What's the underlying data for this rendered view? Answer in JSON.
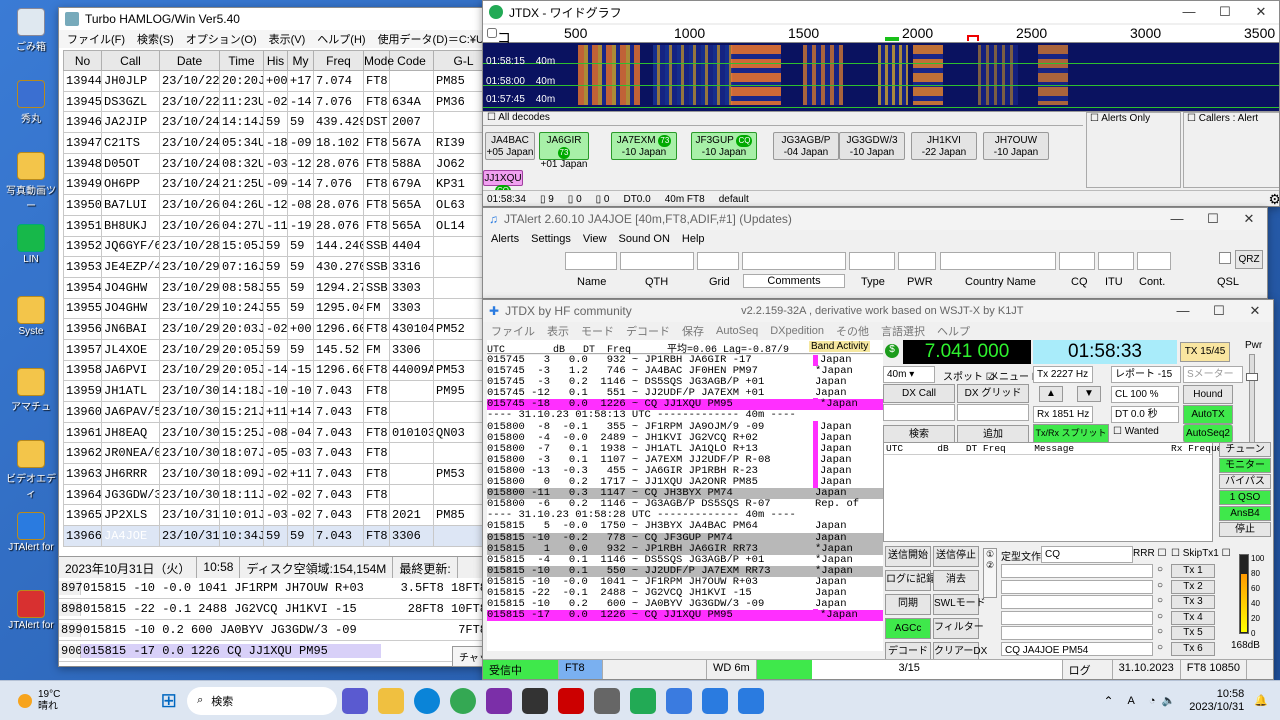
{
  "desktop": {
    "icons": [
      {
        "label": "ごみ箱",
        "icon": "recycle-bin"
      },
      {
        "label": "秀丸",
        "icon": "hidemaru"
      },
      {
        "label": "写真動画ツー",
        "icon": "folder"
      },
      {
        "label": "LIN",
        "icon": "line"
      },
      {
        "label": "Syste",
        "icon": "folder"
      },
      {
        "label": "アマチュ",
        "icon": "folder"
      },
      {
        "label": "ビデオエディ",
        "icon": "folder"
      },
      {
        "label": "JTAlert for",
        "icon": "jtalert"
      },
      {
        "label": "JTAlert for",
        "icon": "jtalert"
      }
    ]
  },
  "hamlog": {
    "title": "Turbo HAMLOG/Win Ver5.40",
    "menu": [
      "ファイル(F)",
      "検索(S)",
      "オプション(O)",
      "表示(V)",
      "ヘルプ(H)",
      "使用データ(D)＝C:¥Users¥toshi¥OneDri"
    ],
    "columns": [
      "No",
      "Call",
      "Date",
      "Time",
      "His",
      "My",
      "Freq",
      "Mode",
      "Code",
      "G-L"
    ],
    "rows": [
      [
        "13944",
        "JH0JLP",
        "23/10/22",
        "20:20J",
        "+00",
        "+17",
        "7.074",
        "FT8",
        "",
        "PM85"
      ],
      [
        "13945",
        "DS3GZL",
        "23/10/22",
        "11:23U",
        "-02",
        "-14",
        "7.076",
        "FT8",
        "634A",
        "PM36"
      ],
      [
        "13946",
        "JA2JIP",
        "23/10/24",
        "14:14J",
        "59",
        "59",
        "439.429",
        "DST",
        "2007",
        ""
      ],
      [
        "13947",
        "C21TS",
        "23/10/24",
        "05:34U",
        "-18",
        "-09",
        "18.102",
        "FT8",
        "567A",
        "RI39"
      ],
      [
        "13948",
        "D05OT",
        "23/10/24",
        "08:32U",
        "-03",
        "-12",
        "28.076",
        "FT8",
        "588A",
        "JO62"
      ],
      [
        "13949",
        "OH6PP",
        "23/10/24",
        "21:25U",
        "-09",
        "-14",
        "7.076",
        "FT8",
        "679A",
        "KP31"
      ],
      [
        "13950",
        "BA7LUI",
        "23/10/26",
        "04:26U",
        "-12",
        "-08",
        "28.076",
        "FT8",
        "565A",
        "OL63"
      ],
      [
        "13951",
        "BH8UKJ",
        "23/10/26",
        "04:27U",
        "-11",
        "-19",
        "28.076",
        "FT8",
        "565A",
        "OL14"
      ],
      [
        "13952",
        "JQ6GYF/6",
        "23/10/28",
        "15:05J",
        "59",
        "59",
        "144.240",
        "SSB",
        "4404",
        ""
      ],
      [
        "13953",
        "JE4EZP/4",
        "23/10/29",
        "07:16J",
        "59",
        "59",
        "430.270",
        "SSB",
        "3316",
        ""
      ],
      [
        "13954",
        "JO4GHW",
        "23/10/29",
        "08:58J",
        "55",
        "59",
        "1294.27",
        "SSB",
        "3303",
        ""
      ],
      [
        "13955",
        "JO4GHW",
        "23/10/29",
        "10:24J",
        "55",
        "59",
        "1295.04",
        "FM",
        "3303",
        ""
      ],
      [
        "13956",
        "JN6BAI",
        "23/10/29",
        "20:03J",
        "-02",
        "+00",
        "1296.60",
        "FT8",
        "430104",
        "PM52"
      ],
      [
        "13957",
        "JL4XOE",
        "23/10/29",
        "20:05J",
        "59",
        "59",
        "145.52",
        "FM",
        "3306",
        ""
      ],
      [
        "13958",
        "JA6PVI",
        "23/10/29",
        "20:05J",
        "-14",
        "-15",
        "1296.60",
        "FT8",
        "44009A",
        "PM53"
      ],
      [
        "13959",
        "JH1ATL",
        "23/10/30",
        "14:18J",
        "-10",
        "-10",
        "7.043",
        "FT8",
        "",
        "PM95"
      ],
      [
        "13960",
        "JA6PAV/5",
        "23/10/30",
        "15:21J",
        "+11",
        "+14",
        "7.043",
        "FT8",
        "",
        ""
      ],
      [
        "13961",
        "JH8EAQ",
        "23/10/30",
        "15:25J",
        "-08",
        "-04",
        "7.043",
        "FT8",
        "010103",
        "QN03"
      ],
      [
        "13962",
        "JR0NEA/0",
        "23/10/30",
        "18:07J",
        "-05",
        "-03",
        "7.043",
        "FT8",
        "",
        ""
      ],
      [
        "13963",
        "JH6RRR",
        "23/10/30",
        "18:09J",
        "-02",
        "+11",
        "7.043",
        "FT8",
        "",
        "PM53"
      ],
      [
        "13964",
        "JG3GDW/3",
        "23/10/30",
        "18:11J",
        "-02",
        "-02",
        "7.043",
        "FT8",
        "",
        ""
      ],
      [
        "13965",
        "JP2XLS",
        "23/10/31",
        "10:01J",
        "-03",
        "-02",
        "7.043",
        "FT8",
        "2021",
        "PM85"
      ],
      [
        "13966",
        "JA4JOE",
        "23/10/31",
        "10:34J",
        "59",
        "59",
        "7.043",
        "FT8",
        "3306",
        ""
      ]
    ],
    "status": [
      "2023年10月31日（火）",
      "10:58",
      "ディスク空領域:154,154M",
      "最終更新:"
    ],
    "band_rows": [
      {
        "n": "897",
        "text": "015815 -10 -0.0 1041  JF1RPM JH7OUW R+03",
        "right": "3.5FT8 18FT8"
      },
      {
        "n": "898",
        "text": "015815 -22 -0.1 2488  JG2VCQ JH1KVI -15",
        "right": "28FT8 10FT8"
      },
      {
        "n": "899",
        "text": "015815 -10  0.2  600  JA0BYV JG3GDW/3 -09",
        "right": "7FT8"
      },
      {
        "n": "900",
        "text": "015815 -17  0.0 1226  CQ JJ1XQU PM95",
        "right": ""
      }
    ],
    "tooltip": "チャット"
  },
  "widegraph": {
    "title": "JTDX - ワイドグラフ",
    "control": "コントロール",
    "scale": [
      "500",
      "1000",
      "1500",
      "2000",
      "2500",
      "3000",
      "3500"
    ],
    "rows": [
      {
        "time": "01:58:15",
        "band": "40m"
      },
      {
        "time": "01:58:00",
        "band": "40m"
      },
      {
        "time": "01:57:45",
        "band": "40m"
      }
    ],
    "all_decodes": "All decodes",
    "alerts_only": "Alerts Only",
    "callers": "Callers : Alert",
    "chips": [
      {
        "call": "JA4BAC",
        "snr": "+05 Japan",
        "num": "",
        "style": "grey"
      },
      {
        "call": "JA6GIR",
        "snr": "+01 Japan",
        "num": "73",
        "style": "green"
      },
      {
        "call": "JA7EXM",
        "snr": "-10 Japan",
        "num": "73",
        "style": "green"
      },
      {
        "call": "JF3GUP",
        "snr": "-10 Japan",
        "num": "CQ",
        "style": "green"
      },
      {
        "call": "JG3AGB/P",
        "snr": "-04 Japan",
        "num": "",
        "style": "grey"
      },
      {
        "call": "JG3GDW/3",
        "snr": "-10 Japan",
        "num": "",
        "style": "grey"
      },
      {
        "call": "JH1KVI",
        "snr": "-22 Japan",
        "num": "",
        "style": "grey"
      },
      {
        "call": "JH7OUW",
        "snr": "-10 Japan",
        "num": "",
        "style": "grey"
      },
      {
        "call": "JJ1XQU",
        "snr": "",
        "num": "CQ",
        "style": "pink"
      }
    ],
    "status": [
      "01:58:34",
      "9",
      "0",
      "0",
      "DT0.0",
      "40m FT8",
      "default"
    ]
  },
  "jtalert": {
    "title": "JTAlert 2.60.10 JA4JOE [40m,FT8,ADIF,#1] (Updates)",
    "menu": [
      "Alerts",
      "Settings",
      "View",
      "Sound ON",
      "Help"
    ],
    "labels": [
      "Name",
      "QTH",
      "Grid",
      "Comments",
      "Type",
      "PWR",
      "Country Name",
      "CQ",
      "ITU",
      "Cont.",
      "QSL"
    ],
    "qrz": "QRZ"
  },
  "jtdx": {
    "title": "JTDX  by HF community",
    "subtitle": "v2.2.159-32A , derivative work based on WSJT-X by K1JT",
    "menu": [
      "ファイル",
      "表示",
      "モード",
      "デコード",
      "保存",
      "AutoSeq",
      "DXpedition",
      "その他",
      "言語選択",
      "ヘルプ"
    ],
    "band_header": "UTC        dB   DT  Freq      平均=0.06 Lag=-0.87/9",
    "band_activity": "Band Activity",
    "lines": [
      {
        "t": "015745   3   0.0   932 ~ JP1RBH JA6GIR -17",
        "c": "Japan",
        "s": "m"
      },
      {
        "t": "015745  -3   1.2   746 ~ JA4BAC JF0HEN PM97",
        "c": "*Japan",
        "s": ""
      },
      {
        "t": "015745  -3   0.2  1146 ~ DS5SQS JG3AGB/P +01",
        "c": "Japan",
        "s": ""
      },
      {
        "t": "015745 -12   0.1   551 ~ JJ2UDF/P JA7EXM +01",
        "c": "Japan",
        "s": ""
      },
      {
        "t": "015745 -18   0.0  1226 ~ CQ JJ1XQU PM95",
        "c": "*Japan",
        "s": "mag"
      },
      {
        "t": "---- 31.10.23 01:58:13 UTC ------------- 40m ----",
        "c": "",
        "s": "sep"
      },
      {
        "t": "015800  -8  -0.1   355 ~ JF1RPM JA9OJM/9 -09",
        "c": "Japan",
        "s": "m"
      },
      {
        "t": "015800  -4  -0.0  2489 ~ JH1KVI JG2VCQ R+02",
        "c": "Japan",
        "s": "m"
      },
      {
        "t": "015800  -7   0.1  1938 ~ JH1ATL JA1QLO R+13",
        "c": "Japan",
        "s": "m"
      },
      {
        "t": "015800  -3   0.1  1107 ~ JA7EXM JJ2UDF/P R-08",
        "c": "Japan",
        "s": "m"
      },
      {
        "t": "015800 -13  -0.3   455 ~ JA6GIR JP1RBH R-23",
        "c": "Japan",
        "s": "m"
      },
      {
        "t": "015800   0   0.2  1717 ~ JJ1XQU JA2ONR PM85",
        "c": "Japan",
        "s": "m"
      },
      {
        "t": "015800 -11   0.3  1147 ~ CQ JH3BYX PM74",
        "c": "Japan",
        "s": "gry"
      },
      {
        "t": "015800  -6   0.2  1146 ~ JG3AGB/P DS5SQS R-07",
        "c": "Rep. of",
        "s": ""
      },
      {
        "t": "---- 31.10.23 01:58:28 UTC ------------- 40m ----",
        "c": "",
        "s": "sep"
      },
      {
        "t": "015815   5  -0.0  1750 ~ JH3BYX JA4BAC PM64",
        "c": "Japan",
        "s": ""
      },
      {
        "t": "015815 -10  -0.2   778 ~ CQ JF3GUP PM74",
        "c": "Japan",
        "s": "gry"
      },
      {
        "t": "015815   1   0.0   932 ~ JP1RBH JA6GIR RR73",
        "c": "*Japan",
        "s": "gry"
      },
      {
        "t": "015815  -4   0.1  1146 ~ DS5SQS JG3AGB/P +01",
        "c": "*Japan",
        "s": ""
      },
      {
        "t": "015815 -10   0.1   550 ~ JJ2UDF/P JA7EXM RR73",
        "c": "*Japan",
        "s": "gry"
      },
      {
        "t": "015815 -10  -0.0  1041 ~ JF1RPM JH7OUW R+03",
        "c": "Japan",
        "s": ""
      },
      {
        "t": "015815 -22  -0.1  2488 ~ JG2VCQ JH1KVI -15",
        "c": "Japan",
        "s": ""
      },
      {
        "t": "015815 -10   0.2   600 ~ JA0BYV JG3GDW/3 -09",
        "c": "Japan",
        "s": ""
      },
      {
        "t": "015815 -17   0.0  1226 ~ CQ JJ1XQU PM95",
        "c": "*Japan",
        "s": "mag"
      }
    ],
    "freq": "7.041 000",
    "clock": "01:58:33",
    "tx_count": "TX 15/45",
    "pwr": "Pwr",
    "band": "40m",
    "spot": "スポット",
    "menu_lbl": "メニュー",
    "dxcall": "DX Call",
    "dxgrid": "DX グリッド",
    "search": "検索",
    "add": "追加",
    "tx_hz": "Tx  2227  Hz",
    "rx_hz": "Rx  1851  Hz",
    "report": "レポート -15",
    "smeter": "Sメーター",
    "cl": "CL  100 %",
    "dt": "DT  0.0 秒",
    "hound": "Hound",
    "autotx": "AutoTX",
    "split": "Tx/Rx スプリット",
    "wanted": "Wanted",
    "autoseq": "AutoSeq2",
    "rx_header": "UTC      dB   DT Freq     Message                 Rx Frequency",
    "right_btns": [
      "チューン",
      "モニター",
      "バイパス",
      "1 QSO",
      "AnsB4",
      "停止"
    ],
    "left_btns": [
      "送信開始",
      "送信停止",
      "ログに記録",
      "消去",
      "同期",
      "SWLモード",
      "AGCc",
      "フィルター",
      "デコード",
      "クリアーDX"
    ],
    "macro_lbl": "定型文作成",
    "macro_val": "CQ",
    "rrr": "RRR",
    "skiptx": "SkipTx1",
    "tx_btns": [
      "Tx 1",
      "Tx 2",
      "Tx 3",
      "Tx 4",
      "Tx 5",
      "Tx 6"
    ],
    "tx6_msg": "CQ  JA4JOE PM54",
    "db_level": "168dB",
    "meter_ticks": [
      "100",
      "80",
      "60",
      "40",
      "20",
      "0"
    ],
    "status": [
      "受信中",
      "FT8",
      "",
      "WD 6m",
      "3/15",
      "ログ",
      "31.10.2023",
      "FT8  10850"
    ]
  },
  "taskbar": {
    "weather_temp": "19°C",
    "weather_desc": "晴れ",
    "search": "検索",
    "time": "10:58",
    "date": "2023/10/31",
    "lang": "A"
  }
}
